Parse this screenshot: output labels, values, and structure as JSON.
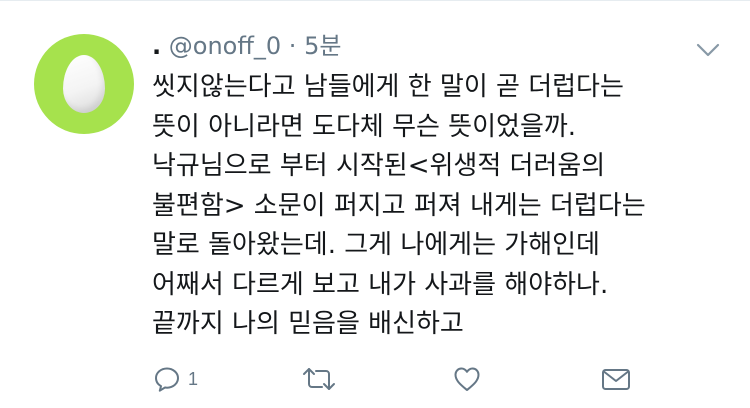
{
  "tweet": {
    "display_name": ".",
    "handle": "@onoff_0",
    "separator": "·",
    "time": "5분",
    "lines": [
      "씻지않는다고 남들에게 한 말이 곧 더럽다는",
      "뜻이 아니라면 도다체 무슨 뜻이었을까.",
      "낙규님으로 부터 시작된<위생적 더러움의",
      "불편함> 소문이 퍼지고 퍼져 내게는 더럽다는",
      "말로 돌아왔는데. 그게 나에게는 가해인데",
      "어째서 다르게 보고 내가 사과를 해야하나.",
      "끝까지 나의 믿음을 배신하고"
    ]
  },
  "actions": {
    "reply_icon": "reply-icon",
    "reply_count": "1",
    "retweet_icon": "retweet-icon",
    "like_icon": "heart-icon",
    "dm_icon": "envelope-icon"
  },
  "colors": {
    "avatar_bg": "#a6e24d",
    "text": "#14171a",
    "meta": "#657786"
  }
}
